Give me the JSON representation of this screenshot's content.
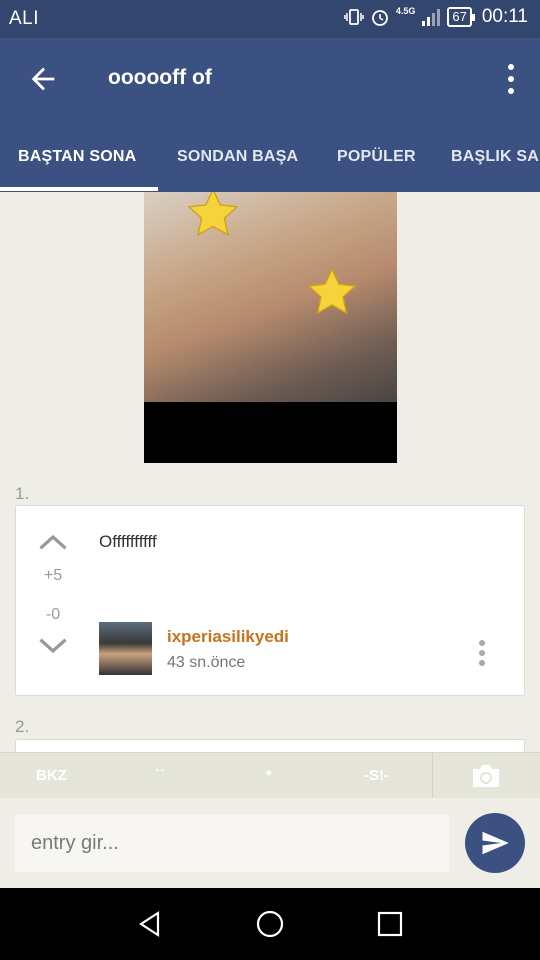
{
  "status_bar": {
    "carrier": "ALI",
    "network": "4.5G",
    "battery": "67",
    "time": "00:11"
  },
  "app_bar": {
    "title": "oooooff of"
  },
  "tabs": [
    {
      "label": "BAŞTAN SONA",
      "active": true
    },
    {
      "label": "SONDAN BAŞA",
      "active": false
    },
    {
      "label": "POPÜLER",
      "active": false
    },
    {
      "label": "BAŞLIK SA",
      "active": false
    }
  ],
  "entries": [
    {
      "number": "1.",
      "text": "Offffffffff",
      "upvotes": "+5",
      "downvotes": "-0",
      "author": "ixperiasilikyedi",
      "time": "43 sn.önce"
    },
    {
      "number": "2."
    }
  ],
  "toolbar": {
    "bkz": "BKZ",
    "backtick": "``",
    "star": "*",
    "spoiler": "-S!-"
  },
  "composer": {
    "placeholder": "entry gir..."
  },
  "colors": {
    "primary": "#3b5182",
    "status_bar": "#33466e",
    "author": "#c8721c",
    "background": "#efeee6"
  }
}
